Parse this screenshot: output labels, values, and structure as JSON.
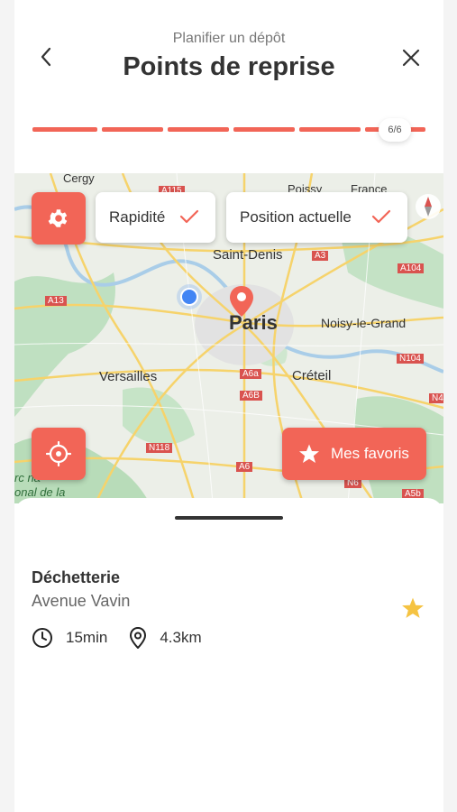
{
  "header": {
    "subtitle": "Planifier un dépôt",
    "title": "Points de reprise",
    "back_icon": "chevron-left-icon",
    "close_icon": "close-icon"
  },
  "progress": {
    "current_step": 6,
    "total_steps": 6,
    "label": "6/6",
    "color": "#f26557"
  },
  "map": {
    "filters": [
      {
        "label": "Rapidité",
        "selected": true
      },
      {
        "label": "Position actuelle",
        "selected": true
      }
    ],
    "favorites_label": "Mes favoris",
    "place_labels": {
      "cergy": "Cergy",
      "poissy": "Poissy",
      "france": "France",
      "saint_denis": "Saint-Denis",
      "paris": "Paris",
      "noisy": "Noisy-le-Grand",
      "versailles": "Versailles",
      "creteil": "Créteil",
      "arc": "rc na",
      "regional": "onal de la"
    },
    "road_labels": {
      "a115": "A115",
      "a3": "A3",
      "a104": "A104",
      "a13": "A13",
      "a6a": "A6a",
      "a6b": "A6B",
      "n104": "N104",
      "n4": "N4",
      "n118": "N118",
      "a6": "A6",
      "n6": "N6",
      "a5b": "A5b"
    }
  },
  "result": {
    "name": "Déchetterie",
    "address": "Avenue Vavin",
    "duration": "15min",
    "distance": "4.3km",
    "favorite": true
  },
  "colors": {
    "accent": "#f26557",
    "star": "#f5c342"
  }
}
